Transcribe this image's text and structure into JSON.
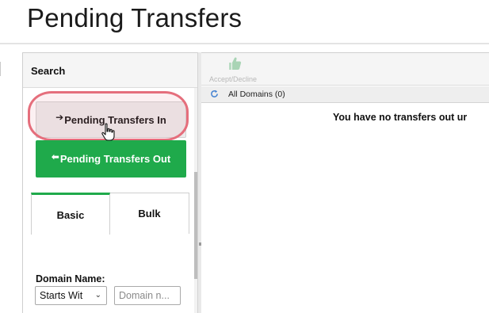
{
  "page": {
    "title": "Pending Transfers"
  },
  "search_panel": {
    "title": "Search",
    "btn_in_label": "Pending Transfers In",
    "btn_out_label": "Pending Transfers Out",
    "arrow_in": "➔",
    "arrow_out": "⬅",
    "tabs": [
      {
        "label": "Basic",
        "active": true
      },
      {
        "label": "Bulk",
        "active": false
      }
    ],
    "domain_name_label": "Domain Name:",
    "match_select_value": "Starts Wit",
    "domain_input_placeholder": "Domain n..."
  },
  "toolbar": {
    "accept_decline_label": "Accept/Decline",
    "icon": "thumbs-up-icon"
  },
  "domains_bar": {
    "label": "All Domains (0)",
    "icon": "refresh-icon"
  },
  "results": {
    "empty_message": "You have no transfers out ur"
  },
  "colors": {
    "accent_green": "#1faa4b",
    "highlight_ring": "#e56e7c"
  }
}
